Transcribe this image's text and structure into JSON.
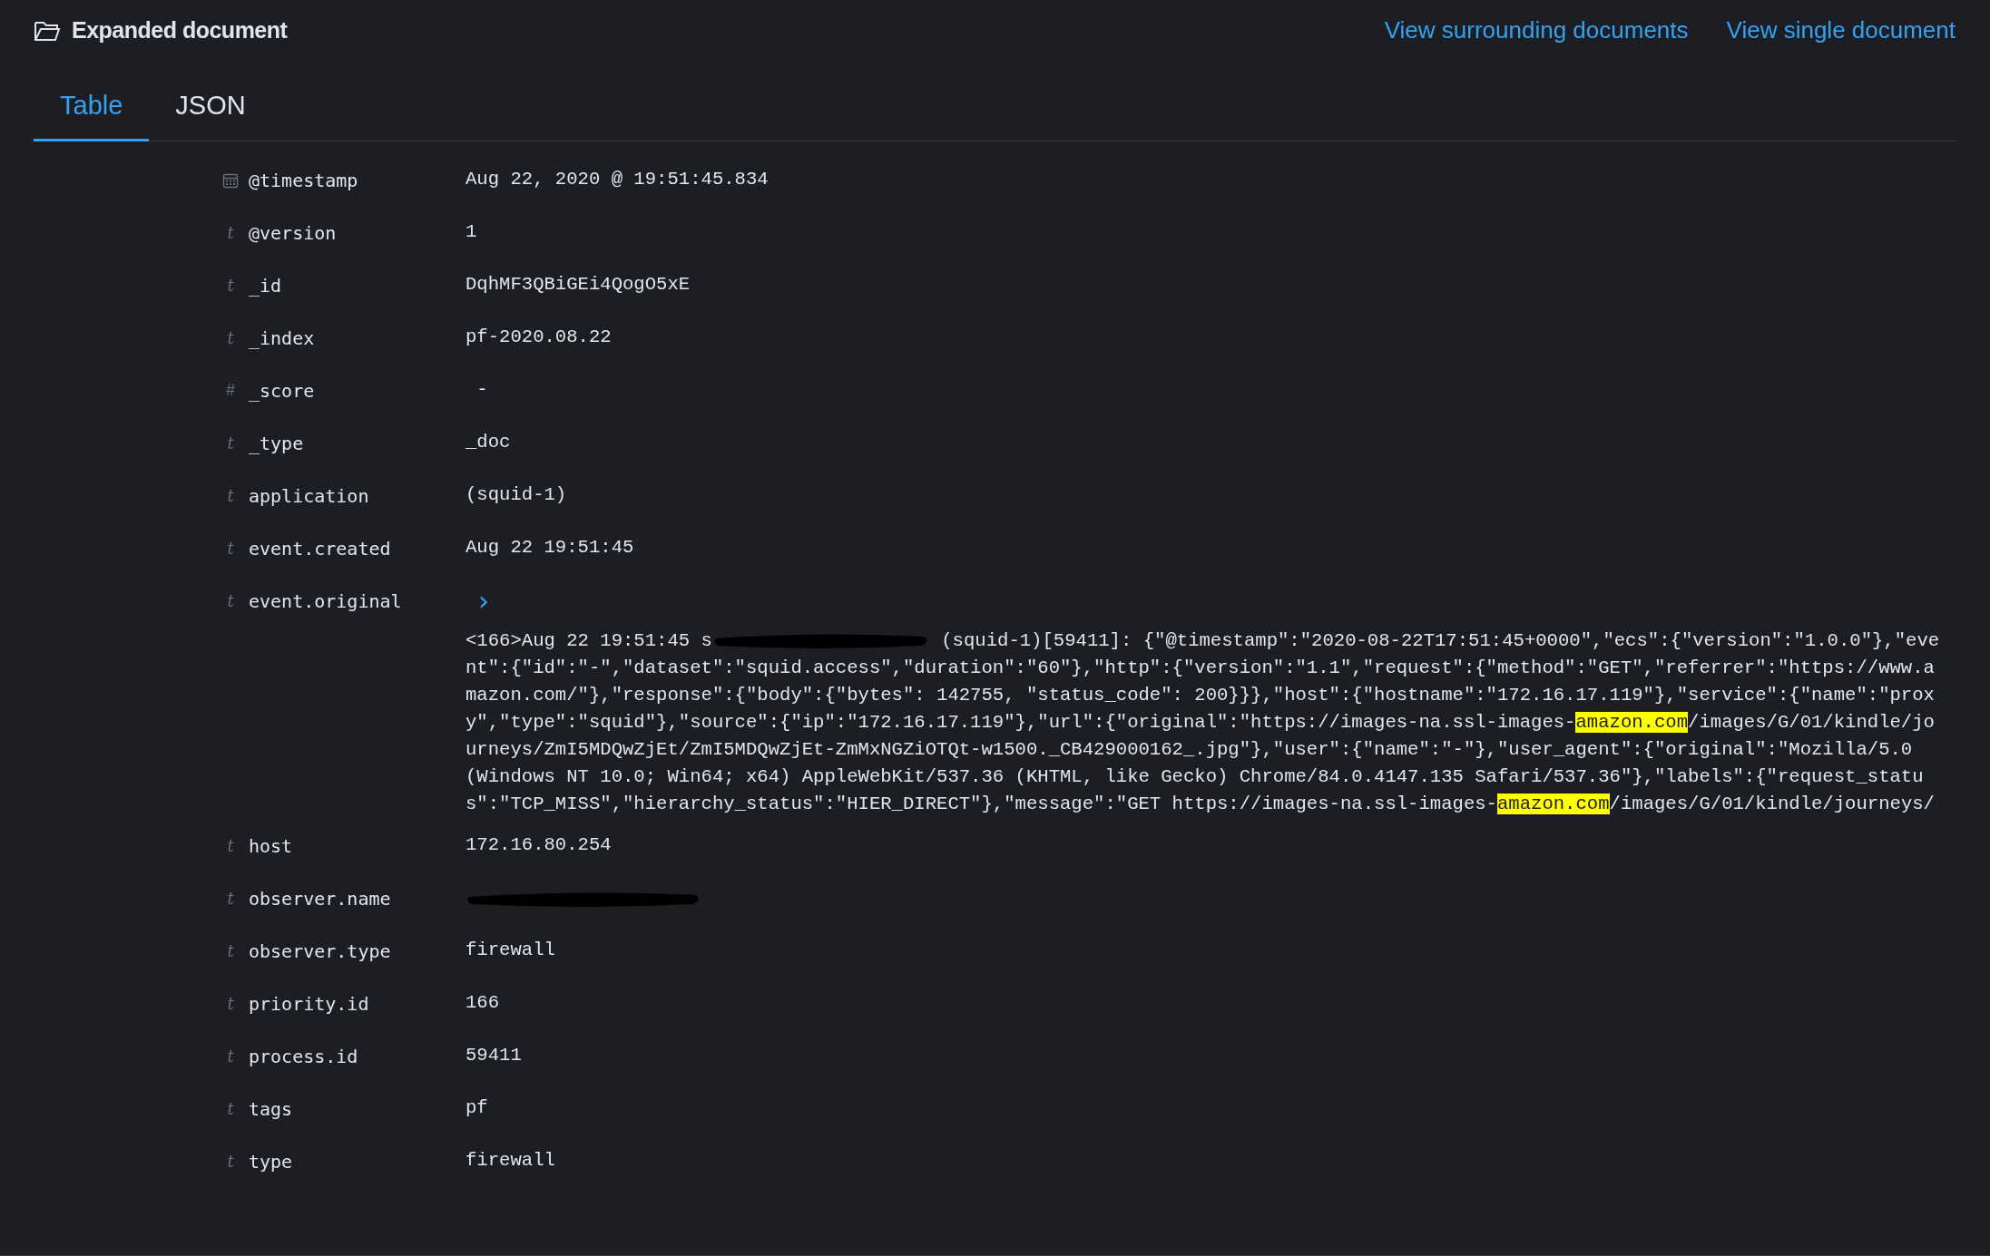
{
  "header": {
    "title": "Expanded document",
    "links": [
      "View surrounding documents",
      "View single document"
    ]
  },
  "tabs": [
    {
      "label": "Table",
      "selected": true
    },
    {
      "label": "JSON",
      "selected": false
    }
  ],
  "fields": [
    {
      "kind": "date",
      "name": "@timestamp",
      "value": "Aug 22, 2020 @ 19:51:45.834"
    },
    {
      "kind": "string",
      "glyph": "t",
      "name": "@version",
      "value": "1"
    },
    {
      "kind": "string",
      "glyph": "t",
      "name": "_id",
      "value": "DqhMF3QBiGEi4QogO5xE"
    },
    {
      "kind": "string",
      "glyph": "t",
      "name": "_index",
      "value": "pf-2020.08.22"
    },
    {
      "kind": "number",
      "glyph": "#",
      "name": "_score",
      "value": " -"
    },
    {
      "kind": "string",
      "glyph": "t",
      "name": "_type",
      "value": "_doc"
    },
    {
      "kind": "string",
      "glyph": "t",
      "name": "application",
      "value": "(squid-1)"
    },
    {
      "kind": "string",
      "glyph": "t",
      "name": "event.created",
      "value": "Aug 22 19:51:45"
    },
    {
      "kind": "string",
      "glyph": "t",
      "name": "event.original",
      "expander": "›",
      "lines": [
        [
          {
            "kind": "text",
            "text": "<166>Aug 22 19:51:45 s"
          },
          {
            "kind": "redacted"
          },
          {
            "kind": "text",
            "text": " (squid-1)[59411]: {\"@timestamp\":\"2020-08-22T17:51:45+0000\",\"ecs\":{\"version\":\"1.0.0\"},\"eve"
          }
        ],
        [
          {
            "kind": "text",
            "text": "nt\":{\"id\":\"-\",\"dataset\":\"squid.access\",\"duration\":\"60\"},\"http\":{\"version\":\"1.1\",\"request\":{\"method\":\"GET\",\"referrer\":\"https://www.a"
          }
        ],
        [
          {
            "kind": "text",
            "text": "mazon.com/\"},\"response\":{\"body\":{\"bytes\": 142755, \"status_code\": 200}}},\"host\":{\"hostname\":\"172.16.17.119\"},\"service\":{\"name\":\"prox"
          }
        ],
        [
          {
            "kind": "text",
            "text": "y\",\"type\":\"squid\"},\"source\":{\"ip\":\"172.16.17.119\"},\"url\":{\"original\":\"https://images-na.ssl-images-"
          },
          {
            "kind": "highlight",
            "text": "amazon.com"
          },
          {
            "kind": "text",
            "text": "/images/G/01/kindle/jo"
          }
        ],
        [
          {
            "kind": "text",
            "text": "urneys/ZmI5MDQwZjEt/ZmI5MDQwZjEt-ZmMxNGZiOTQt-w1500._CB429000162_.jpg\"},\"user\":{\"name\":\"-\"},\"user_agent\":{\"original\":\"Mozilla/5.0"
          }
        ],
        [
          {
            "kind": "text",
            "text": "(Windows NT 10.0; Win64; x64) AppleWebKit/537.36 (KHTML, like Gecko) Chrome/84.0.4147.135 Safari/537.36\"},\"labels\":{\"request_statu"
          }
        ],
        [
          {
            "kind": "text",
            "text": "s\":\"TCP_MISS\",\"hierarchy_status\":\"HIER_DIRECT\"},\"message\":\"GET https://images-na.ssl-images-"
          },
          {
            "kind": "highlight",
            "text": "amazon.com"
          },
          {
            "kind": "text",
            "text": "/images/G/01/kindle/journeys/"
          }
        ]
      ]
    },
    {
      "kind": "string",
      "glyph": "t",
      "name": "host",
      "value": "172.16.80.254"
    },
    {
      "kind": "string",
      "glyph": "t",
      "name": "observer.name",
      "redacted": true
    },
    {
      "kind": "string",
      "glyph": "t",
      "name": "observer.type",
      "value": "firewall"
    },
    {
      "kind": "string",
      "glyph": "t",
      "name": "priority.id",
      "value": "166"
    },
    {
      "kind": "string",
      "glyph": "t",
      "name": "process.id",
      "value": "59411"
    },
    {
      "kind": "string",
      "glyph": "t",
      "name": "tags",
      "value": "pf"
    },
    {
      "kind": "string",
      "glyph": "t",
      "name": "type",
      "value": "firewall"
    }
  ]
}
